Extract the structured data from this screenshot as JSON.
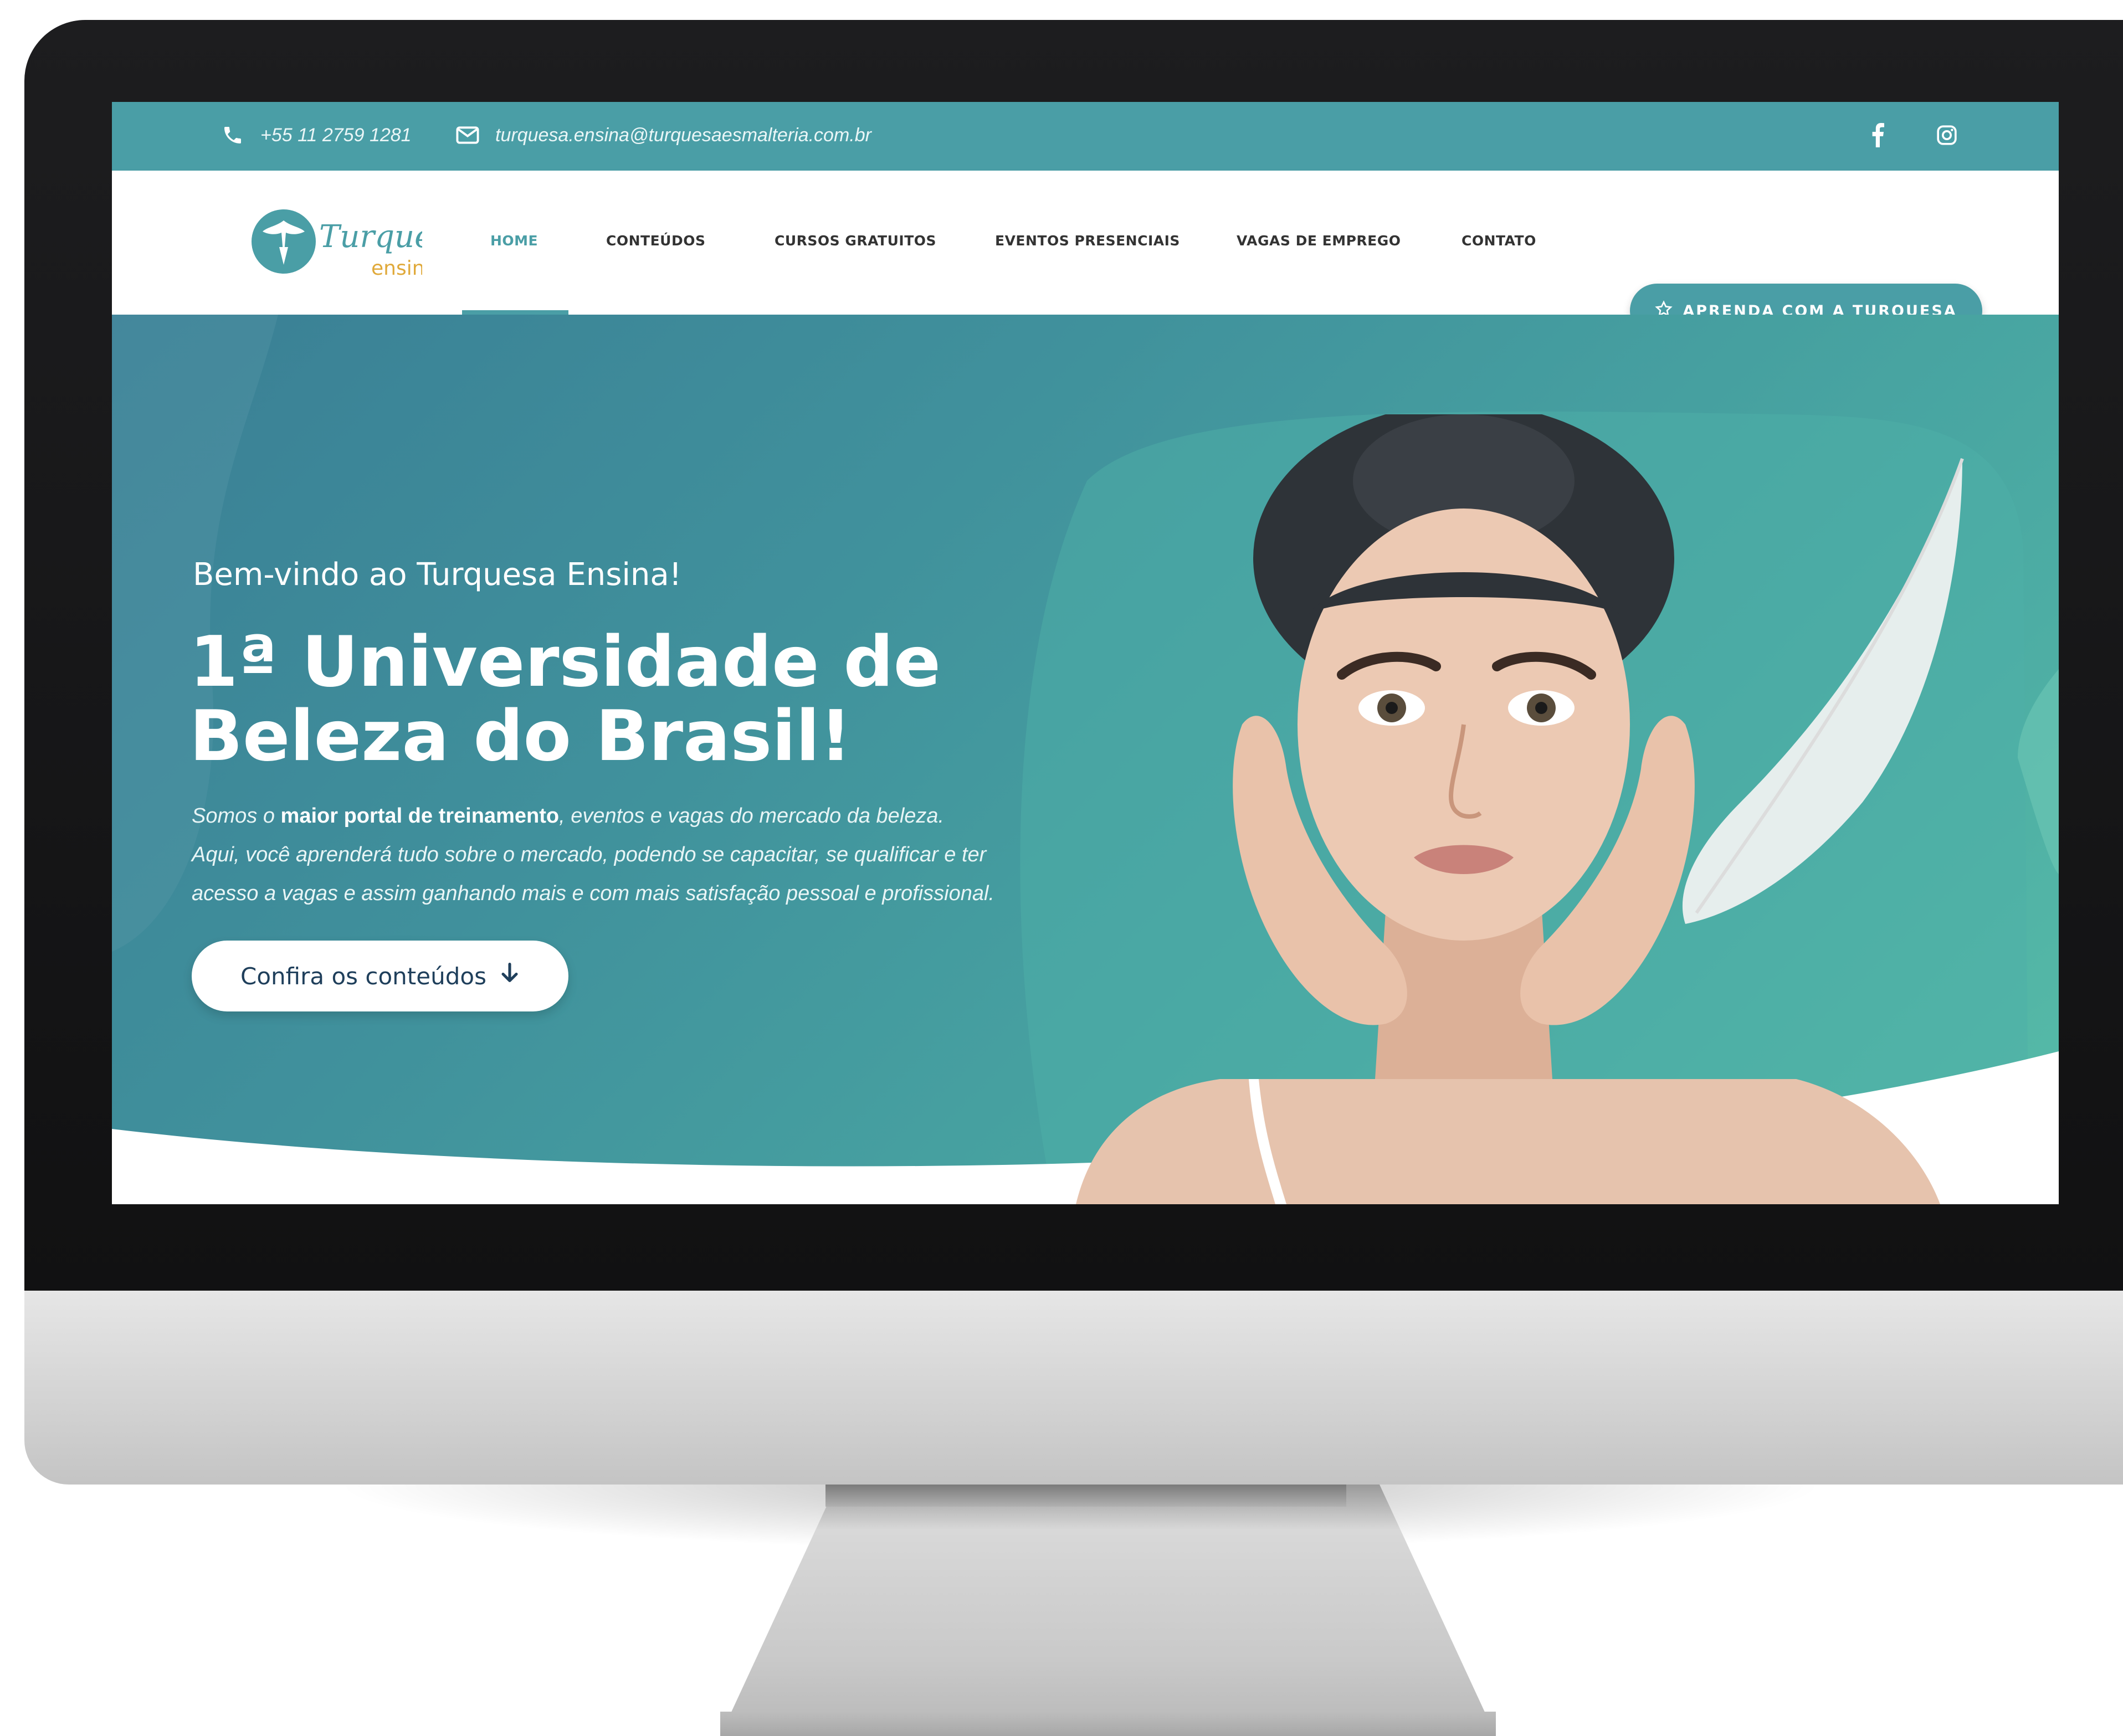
{
  "topbar": {
    "phone": "+55 11 2759 1281",
    "email": "turquesa.ensina@turquesaesmalteria.com.br"
  },
  "logo": {
    "line1": "Turquesa",
    "line2": "ensina"
  },
  "nav": {
    "items": [
      {
        "label": "HOME"
      },
      {
        "label": "CONTEÚDOS"
      },
      {
        "label": "CURSOS GRATUITOS"
      },
      {
        "label": "EVENTOS PRESENCIAIS"
      },
      {
        "label": "VAGAS DE EMPREGO"
      },
      {
        "label": "CONTATO"
      }
    ],
    "cta_label": "APRENDA COM A TURQUESA"
  },
  "hero": {
    "welcome": "Bem-vindo ao Turquesa Ensina!",
    "title_line1": "1ª Universidade de",
    "title_line2": "Beleza do Brasil!",
    "desc_prefix": "Somos o ",
    "desc_bold": "maior portal de treinamento",
    "desc_after_bold": ", eventos e vagas do mercado da beleza.",
    "desc_line2": "Aqui, você aprenderá tudo sobre o mercado, podendo se capacitar, se qualificar e ter",
    "desc_line3": "acesso a vagas e assim ganhando mais e com mais satisfação pessoal e profissional.",
    "cta_label": "Confira os conteúdos"
  },
  "colors": {
    "brand_teal": "#4a9ea6",
    "hero_gradient_start": "#3a7f95",
    "hero_gradient_end": "#57bca8",
    "logo_gold": "#e0a93a"
  },
  "icons": {
    "phone": "phone-icon",
    "email": "envelope-icon",
    "facebook": "facebook-icon",
    "instagram": "instagram-icon",
    "star": "star-icon",
    "arrow": "arrow-down-icon"
  }
}
